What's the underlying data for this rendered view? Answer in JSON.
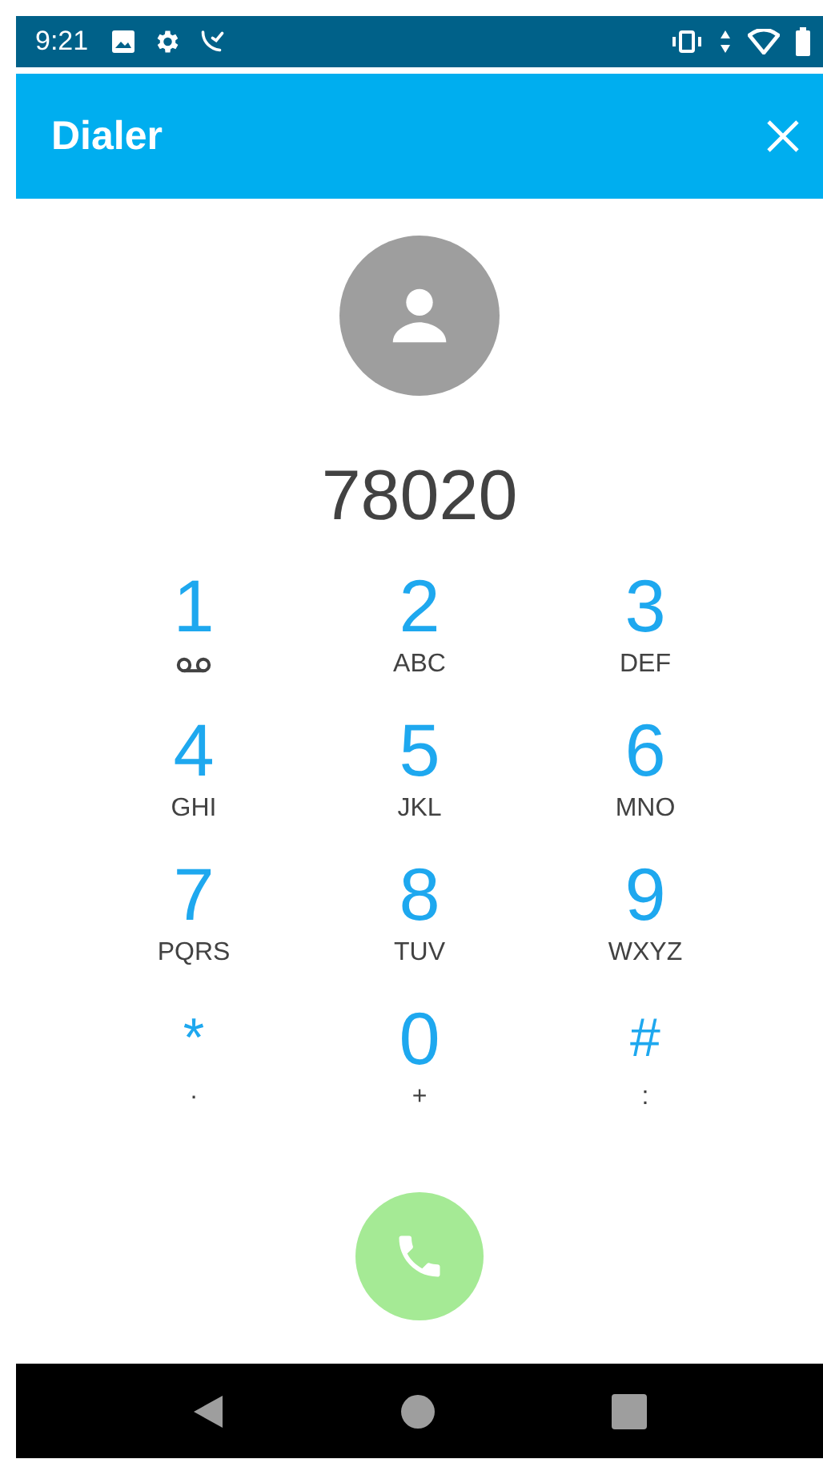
{
  "status_bar": {
    "time": "9:21"
  },
  "app_bar": {
    "title": "Dialer"
  },
  "number": "78020",
  "keys": [
    {
      "digit": "1",
      "kind": "voicemail"
    },
    {
      "digit": "2",
      "kind": "letters",
      "letters": "ABC"
    },
    {
      "digit": "3",
      "kind": "letters",
      "letters": "DEF"
    },
    {
      "digit": "4",
      "kind": "letters",
      "letters": "GHI"
    },
    {
      "digit": "5",
      "kind": "letters",
      "letters": "JKL"
    },
    {
      "digit": "6",
      "kind": "letters",
      "letters": "MNO"
    },
    {
      "digit": "7",
      "kind": "letters",
      "letters": "PQRS"
    },
    {
      "digit": "8",
      "kind": "letters",
      "letters": "TUV"
    },
    {
      "digit": "9",
      "kind": "letters",
      "letters": "WXYZ"
    },
    {
      "digit": "*",
      "kind": "letters",
      "letters": "·"
    },
    {
      "digit": "0",
      "kind": "letters",
      "letters": "+"
    },
    {
      "digit": "#",
      "kind": "letters",
      "letters": ":"
    }
  ]
}
